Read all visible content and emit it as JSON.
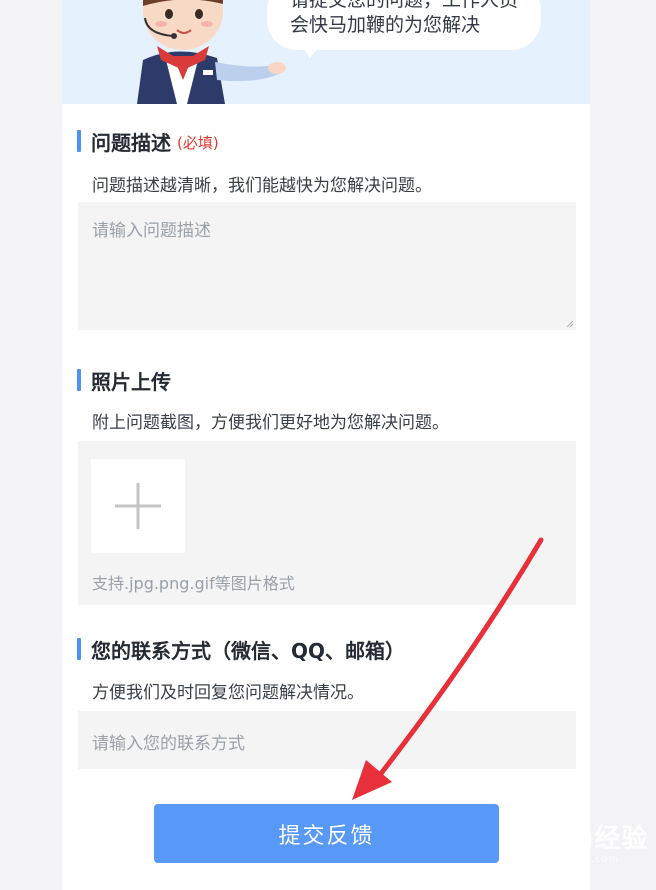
{
  "banner": {
    "bubble_line1": "请提交您的问题，工作人员",
    "bubble_line2": "会快马加鞭的为您解决"
  },
  "problem": {
    "title": "问题描述",
    "required_label": "(必填)",
    "description": "问题描述越清晰，我们能越快为您解决问题。",
    "placeholder": "请输入问题描述"
  },
  "photo": {
    "title": "照片上传",
    "description": "附上问题截图，方便我们更好地为您解决问题。",
    "formats_hint": "支持.jpg.png.gif等图片格式"
  },
  "contact": {
    "title": "您的联系方式（微信、QQ、邮箱）",
    "description": "方便我们及时回复您问题解决情况。",
    "placeholder": "请输入您的联系方式"
  },
  "submit_label": "提交反馈",
  "watermark": {
    "main": "Baidu经验",
    "sub": "jingyan.baidu.com"
  },
  "colors": {
    "accent": "#4f93ef",
    "button": "#5898f7",
    "required": "#e23a2f",
    "arrow": "#e8303a"
  }
}
